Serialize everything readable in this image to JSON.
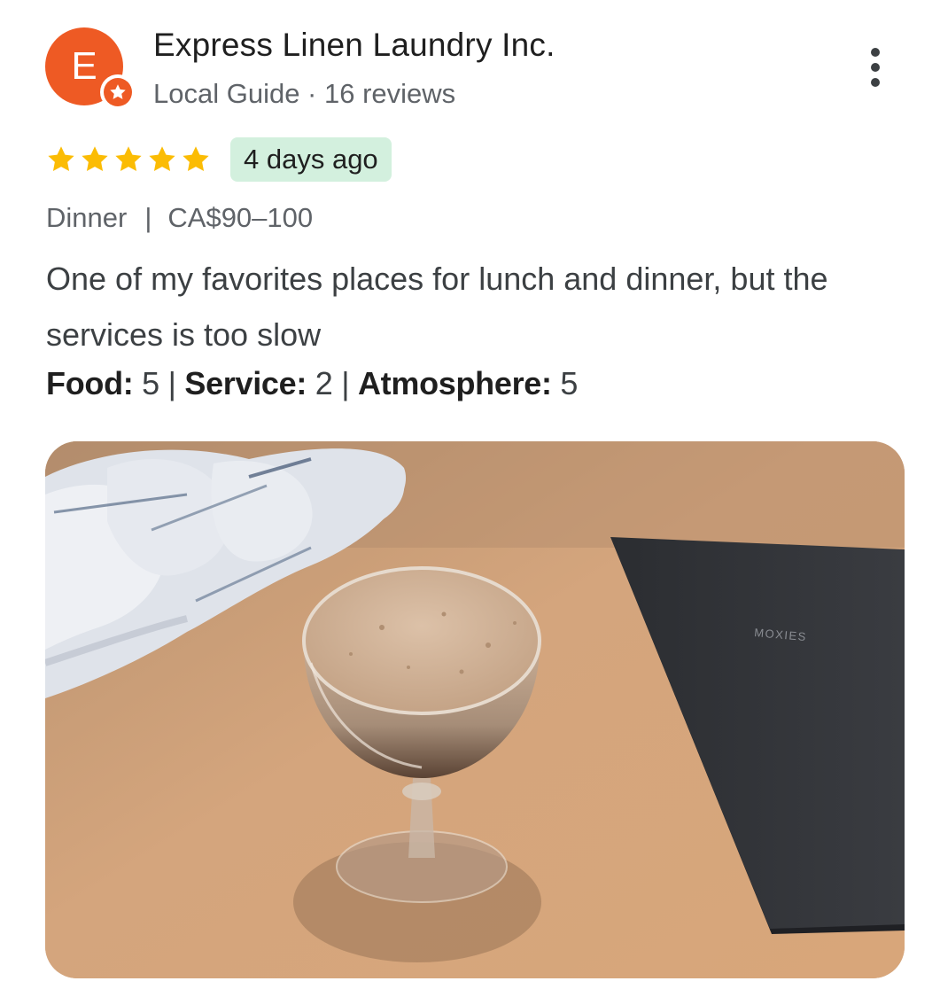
{
  "reviewer": {
    "initial": "E",
    "name": "Express Linen Laundry Inc.",
    "meta": "Local Guide · 16 reviews"
  },
  "review": {
    "stars": 5,
    "time_ago": "4 days ago",
    "meal": "Dinner",
    "separator": "|",
    "price": "CA$90–100",
    "text": "One of my favorites places for lunch and dinner, but the services is too slow",
    "ratings": [
      {
        "label": "Food:",
        "value": "5"
      },
      {
        "label": "Service:",
        "value": "2"
      },
      {
        "label": "Atmosphere:",
        "value": "5"
      }
    ],
    "rating_separator": "|"
  },
  "photo": {
    "menu_text": "MOXIES"
  },
  "colors": {
    "avatar": "#ee5a24",
    "star": "#fbbc04",
    "time_badge_bg": "#d3f0de"
  },
  "icons": {
    "more": "more-vert-icon",
    "star": "star-icon",
    "badge": "local-guide-star-icon"
  }
}
